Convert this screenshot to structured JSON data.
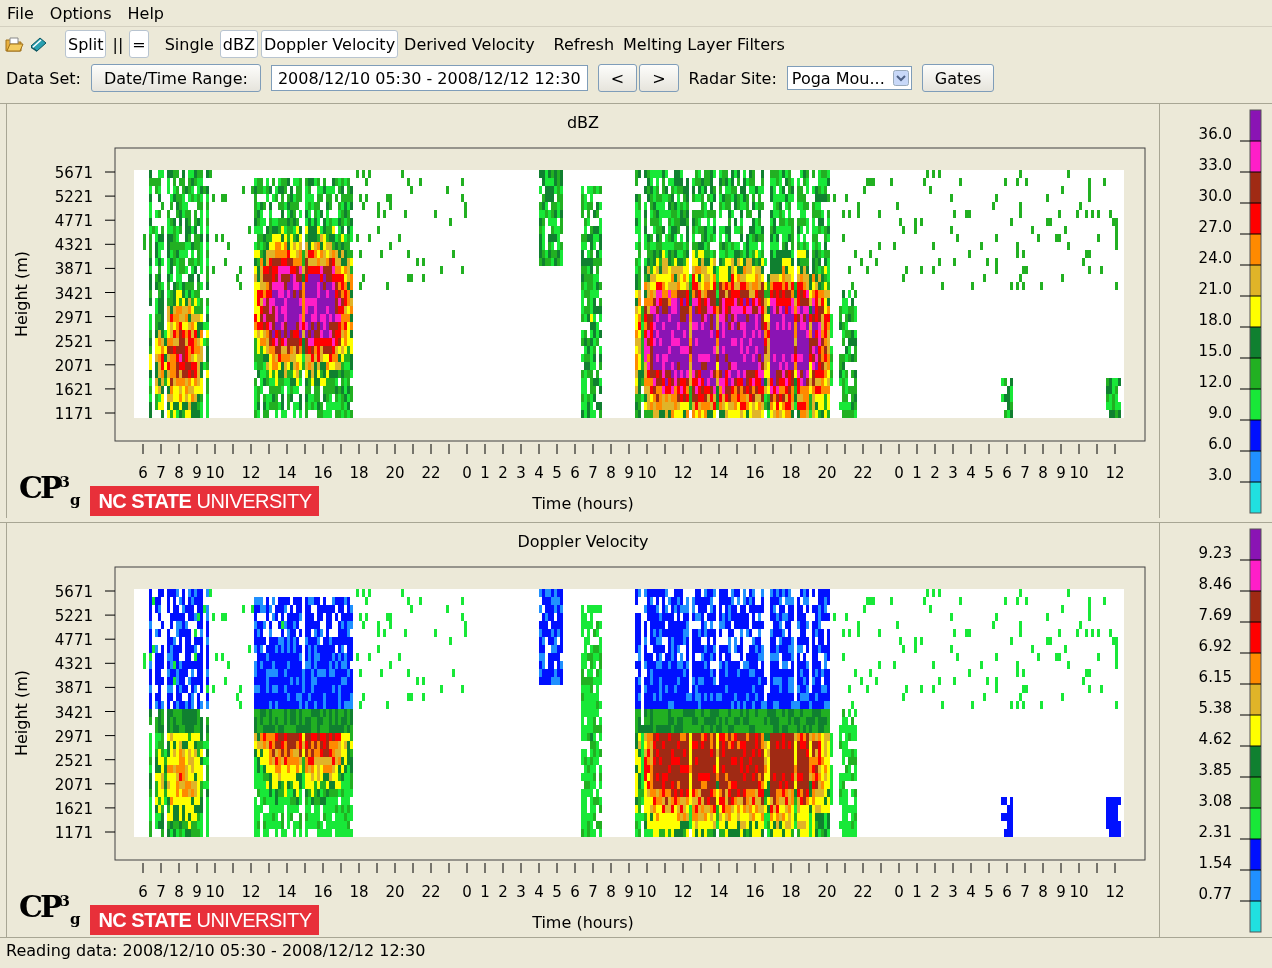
{
  "menu": [
    "File",
    "Options",
    "Help"
  ],
  "toolbar": [
    {
      "label": "Split",
      "selected": true
    },
    {
      "label": "||",
      "selected": false
    },
    {
      "label": "=",
      "selected": true
    },
    {
      "label": "Single",
      "selected": false
    },
    {
      "label": "dBZ",
      "selected": true
    },
    {
      "label": "Doppler Velocity",
      "selected": true
    },
    {
      "label": "Derived Velocity",
      "selected": false
    },
    {
      "label": "Refresh",
      "selected": false
    },
    {
      "label": "Melting Layer Filters",
      "selected": false
    }
  ],
  "data_set": {
    "label": "Data Set:",
    "range_button": "Date/Time Range:",
    "range_value": "2008/12/10 05:30 - 2008/12/12 12:30",
    "prev_button": "<",
    "next_button": ">",
    "site_label": "Radar Site:",
    "site_value": "Poga Mou...",
    "gates_button": "Gates"
  },
  "panels": [
    {
      "kind": "reflectivity",
      "title": "dBZ",
      "ylabel": "Height (m)",
      "xlabel": "Time (hours)",
      "yticks": [
        "5671",
        "5221",
        "4771",
        "4321",
        "3871",
        "3421",
        "2971",
        "2521",
        "2071",
        "1621",
        "1171"
      ],
      "xticks": [
        "6",
        "7",
        "8",
        "9",
        "10",
        "12",
        "14",
        "16",
        "18",
        "20",
        "22",
        "0",
        "1",
        "2",
        "3",
        "4",
        "5",
        "6",
        "7",
        "8",
        "9",
        "10",
        "12",
        "14",
        "16",
        "18",
        "20",
        "22",
        "0",
        "1",
        "2",
        "3",
        "4",
        "5",
        "6",
        "7",
        "8",
        "9",
        "10",
        "12"
      ],
      "legend": {
        "labels": [
          "36.0",
          "33.0",
          "30.0",
          "27.0",
          "24.0",
          "21.0",
          "18.0",
          "15.0",
          "12.0",
          "9.0",
          "6.0",
          "3.0"
        ],
        "segments": [
          {
            "color": "#8a14b4"
          },
          {
            "color": "#ff1ec8"
          },
          {
            "color": "#a02a14"
          },
          {
            "color": "#ff0000"
          },
          {
            "color": "#ff8a00"
          },
          {
            "color": "#e0b428"
          },
          {
            "color": "#ffff00"
          },
          {
            "color": "#108030"
          },
          {
            "color": "#22b022"
          },
          {
            "color": "#18e838"
          },
          {
            "color": "#0010ff"
          },
          {
            "color": "#2090ff"
          },
          {
            "color": "#20e0e0"
          }
        ]
      },
      "logo": "CP$^{3}$$_{g}$",
      "university": "**NC STATE** UNIVERSITY"
    },
    {
      "kind": "velocity",
      "title": "Doppler Velocity",
      "ylabel": "Height (m)",
      "xlabel": "Time (hours)",
      "yticks": [
        "5671",
        "5221",
        "4771",
        "4321",
        "3871",
        "3421",
        "2971",
        "2521",
        "2071",
        "1621",
        "1171"
      ],
      "xticks": [
        "6",
        "7",
        "8",
        "9",
        "10",
        "12",
        "14",
        "16",
        "18",
        "20",
        "22",
        "0",
        "1",
        "2",
        "3",
        "4",
        "5",
        "6",
        "7",
        "8",
        "9",
        "10",
        "12",
        "14",
        "16",
        "18",
        "20",
        "22",
        "0",
        "1",
        "2",
        "3",
        "4",
        "5",
        "6",
        "7",
        "8",
        "9",
        "10",
        "12"
      ],
      "legend": {
        "labels": [
          "9.23",
          "8.46",
          "7.69",
          "6.92",
          "6.15",
          "5.38",
          "4.62",
          "3.85",
          "3.08",
          "2.31",
          "1.54",
          "0.77"
        ],
        "segments": [
          {
            "color": "#8a14b4"
          },
          {
            "color": "#ff1ec8"
          },
          {
            "color": "#a02a14"
          },
          {
            "color": "#ff0000"
          },
          {
            "color": "#ff8a00"
          },
          {
            "color": "#e0b428"
          },
          {
            "color": "#ffff00"
          },
          {
            "color": "#108030"
          },
          {
            "color": "#22b022"
          },
          {
            "color": "#18e838"
          },
          {
            "color": "#0010ff"
          },
          {
            "color": "#2090ff"
          },
          {
            "color": "#20e0e0"
          }
        ]
      },
      "logo": "CP$^{3}$$_{g}$",
      "university": "**NC STATE** UNIVERSITY"
    }
  ],
  "status_bar": "Reading data: 2008/12/10 05:30 - 2008/12/12 12:30"
}
